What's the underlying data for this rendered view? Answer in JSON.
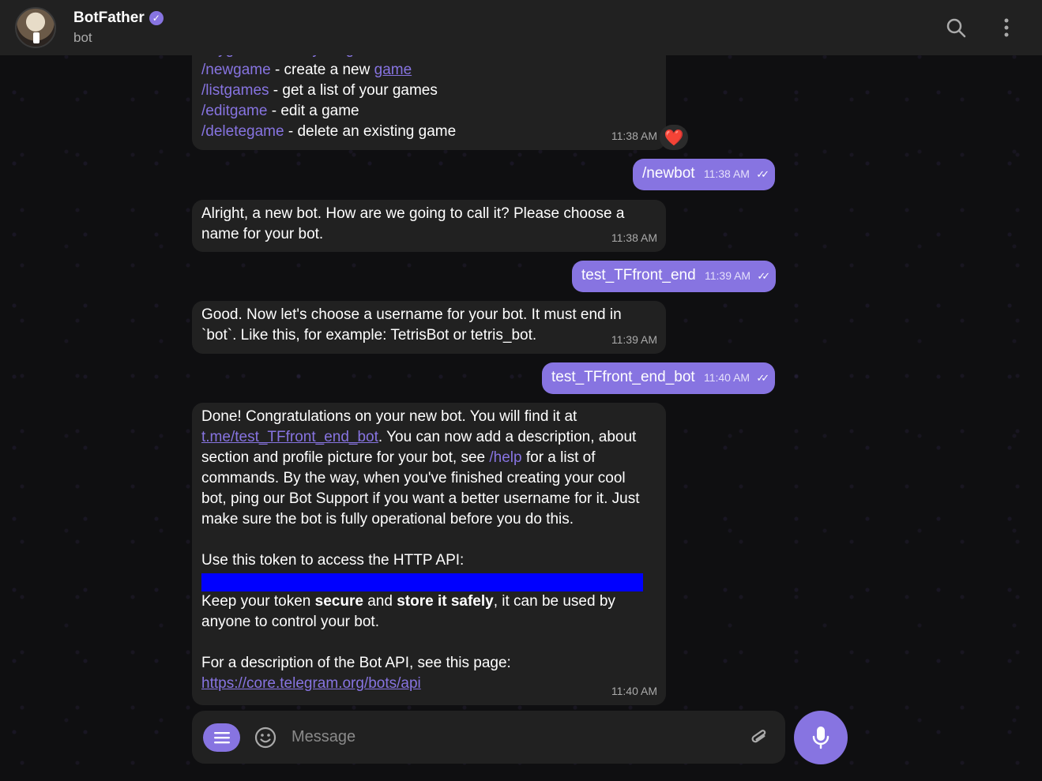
{
  "header": {
    "title": "BotFather",
    "subtitle": "bot"
  },
  "messages": {
    "cut_off_line": "/mygames - edit your games",
    "commands": [
      {
        "cmd": "/newgame",
        "text_before": " - create a new ",
        "link": "game"
      },
      {
        "cmd": "/listgames",
        "text": " - get a list of your games"
      },
      {
        "cmd": "/editgame",
        "text": " - edit a game"
      },
      {
        "cmd": "/deletegame",
        "text": " - delete an existing game"
      }
    ],
    "commands_time": "11:38 AM",
    "reaction": "❤️",
    "out1": {
      "text": "/newbot",
      "time": "11:38 AM"
    },
    "in1": {
      "text": "Alright, a new bot. How are we going to call it? Please choose a name for your bot.",
      "time": "11:38 AM"
    },
    "out2": {
      "text": "test_TFfront_end",
      "time": "11:39 AM"
    },
    "in2": {
      "text": "Good. Now let's choose a username for your bot. It must end in `bot`. Like this, for example: TetrisBot or tetris_bot.",
      "time": "11:39 AM"
    },
    "out3": {
      "text": "test_TFfront_end_bot",
      "time": "11:40 AM"
    },
    "in3": {
      "p1_a": "Done! Congratulations on your new bot. You will find it at ",
      "p1_link": "t.me/test_TFfront_end_bot",
      "p1_b": ". You can now add a description, about section and profile picture for your bot, see ",
      "p1_cmd": "/help",
      "p1_c": " for a list of commands. By the way, when you've finished creating your cool bot, ping our Bot Support if you want a better username for it. Just make sure the bot is fully operational before you do this.",
      "p2": "Use this token to access the HTTP API:",
      "p3_a": "Keep your token ",
      "p3_b1": "secure",
      "p3_c": " and ",
      "p3_b2": "store it safely",
      "p3_d": ", it can be used by anyone to control your bot.",
      "p4": "For a description of the Bot API, see this page:",
      "p4_link": "https://core.telegram.org/bots/api",
      "time": "11:40 AM"
    }
  },
  "composer": {
    "placeholder": "Message"
  },
  "colors": {
    "accent": "#8774e1",
    "bubble_in": "#212121",
    "token_redaction": "#0000ff"
  },
  "icons": [
    "search-icon",
    "more-vertical-icon",
    "menu-icon",
    "emoji-icon",
    "paperclip-icon",
    "microphone-icon",
    "verified-icon",
    "read-check-icon",
    "heart-icon"
  ]
}
